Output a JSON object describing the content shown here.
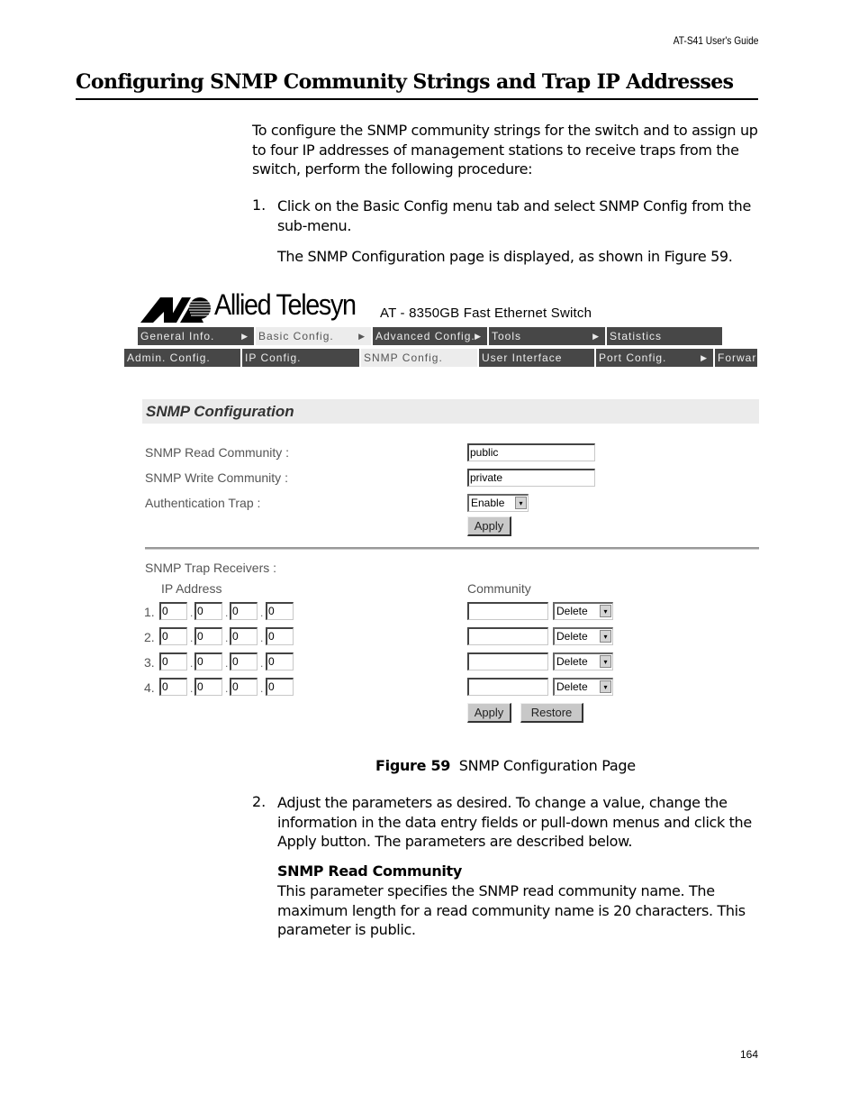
{
  "header": {
    "guide_title": "AT-S41 User's Guide"
  },
  "section": {
    "title": "Configuring SNMP Community Strings and Trap IP Addresses"
  },
  "intro": "To configure the SNMP community strings for the switch and to assign up to four IP addresses of management stations to receive traps from the switch, perform the following procedure:",
  "steps": [
    {
      "num": "1.",
      "text": "Click on the Basic Config menu tab and select SNMP Config from the sub-menu.",
      "note": "The SNMP Configuration page is displayed, as shown in Figure 59."
    },
    {
      "num": "2.",
      "text": "Adjust the parameters as desired. To change a value, change the information in the data entry fields or pull-down menus and click the Apply button. The parameters are described below."
    }
  ],
  "figure": {
    "brand": "Allied Telesyn",
    "model": "AT - 8350GB Fast Ethernet Switch",
    "menu_row1": [
      {
        "label": "General Info.",
        "arrow": "▶",
        "active": false
      },
      {
        "label": "Basic Config.",
        "arrow": "▶",
        "active": true
      },
      {
        "label": "Advanced Config.",
        "arrow": "▶",
        "active": false
      },
      {
        "label": "Tools",
        "arrow": "▶",
        "active": false
      },
      {
        "label": "Statistics",
        "arrow": "",
        "active": false
      }
    ],
    "menu_row2": [
      {
        "label": "Admin. Config.",
        "arrow": "",
        "active": false
      },
      {
        "label": "IP Config.",
        "arrow": "",
        "active": false
      },
      {
        "label": "SNMP Config.",
        "arrow": "",
        "active": true
      },
      {
        "label": "User Interface",
        "arrow": "",
        "active": false
      },
      {
        "label": "Port Config.",
        "arrow": "▶",
        "active": false
      },
      {
        "label": "Forwar",
        "arrow": "",
        "active": false
      }
    ],
    "page_title": "SNMP Configuration",
    "read_community_label": "SNMP Read Community :",
    "read_community_value": "public",
    "write_community_label": "SNMP Write Community :",
    "write_community_value": "private",
    "auth_trap_label": "Authentication Trap :",
    "auth_trap_value": "Enable",
    "apply_label": "Apply",
    "trap_receivers_label": "SNMP Trap Receivers :",
    "ip_address_header": "IP Address",
    "community_header": "Community",
    "dropdown_icon": "▾",
    "ip_separator": ".",
    "receivers": [
      {
        "num": "1.",
        "ip": [
          "0",
          "0",
          "0",
          "0"
        ],
        "community": "",
        "action": "Delete"
      },
      {
        "num": "2.",
        "ip": [
          "0",
          "0",
          "0",
          "0"
        ],
        "community": "",
        "action": "Delete"
      },
      {
        "num": "3.",
        "ip": [
          "0",
          "0",
          "0",
          "0"
        ],
        "community": "",
        "action": "Delete"
      },
      {
        "num": "4.",
        "ip": [
          "0",
          "0",
          "0",
          "0"
        ],
        "community": "",
        "action": "Delete"
      }
    ],
    "apply2_label": "Apply",
    "restore_label": "Restore"
  },
  "caption": {
    "label": "Figure 59",
    "text": "SNMP Configuration Page"
  },
  "param": {
    "title": "SNMP Read Community",
    "desc": "This parameter specifies the SNMP read community name. The maximum length for a read community name is 20 characters. This parameter is public."
  },
  "footer": {
    "page_number": "164"
  }
}
